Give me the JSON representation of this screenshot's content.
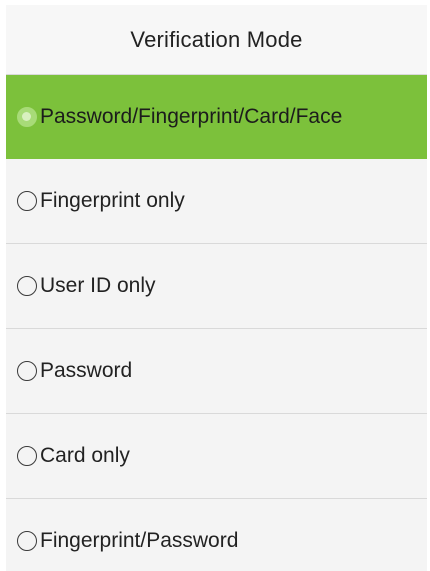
{
  "header": {
    "title": "Verification Mode"
  },
  "options": [
    {
      "label": "Password/Fingerprint/Card/Face",
      "selected": true
    },
    {
      "label": "Fingerprint only",
      "selected": false
    },
    {
      "label": "User ID only",
      "selected": false
    },
    {
      "label": "Password",
      "selected": false
    },
    {
      "label": "Card only",
      "selected": false
    },
    {
      "label": "Fingerprint/Password",
      "selected": false
    }
  ],
  "colors": {
    "selected_background": "#7cc13b",
    "background": "#f4f4f4",
    "divider": "#d9d9d9",
    "text": "#222222"
  },
  "icons": {
    "radio": "radio-button-icon"
  }
}
